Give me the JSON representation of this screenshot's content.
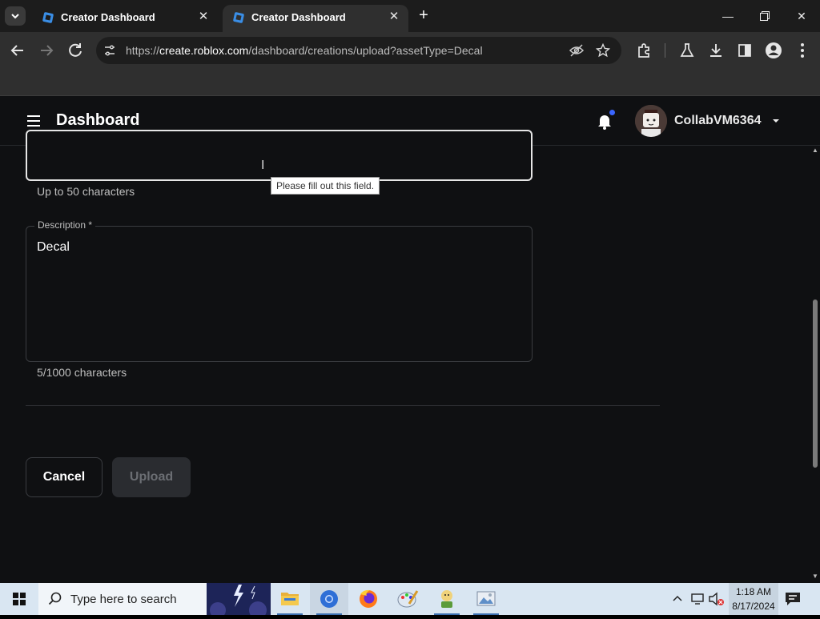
{
  "browser": {
    "tabs": [
      {
        "title": "Creator Dashboard",
        "active": false
      },
      {
        "title": "Creator Dashboard",
        "active": true
      }
    ],
    "url_prefix": "https://",
    "url_host": "create.roblox.com",
    "url_path": "/dashboard/creations/upload?assetType=Decal"
  },
  "header": {
    "title": "Dashboard",
    "username": "CollabVM6364"
  },
  "form": {
    "name_helper": "Up to 50 characters",
    "tooltip": "Please fill out this field.",
    "description_label": "Description *",
    "description_value": "Decal",
    "description_helper": "5/1000 characters",
    "cancel_label": "Cancel",
    "upload_label": "Upload"
  },
  "taskbar": {
    "search_placeholder": "Type here to search",
    "time": "1:18 AM",
    "date": "8/17/2024"
  },
  "colors": {
    "page_bg": "#0f1012",
    "accent_dot": "#3a66ff",
    "taskbar_bg": "#d9e6f2"
  }
}
